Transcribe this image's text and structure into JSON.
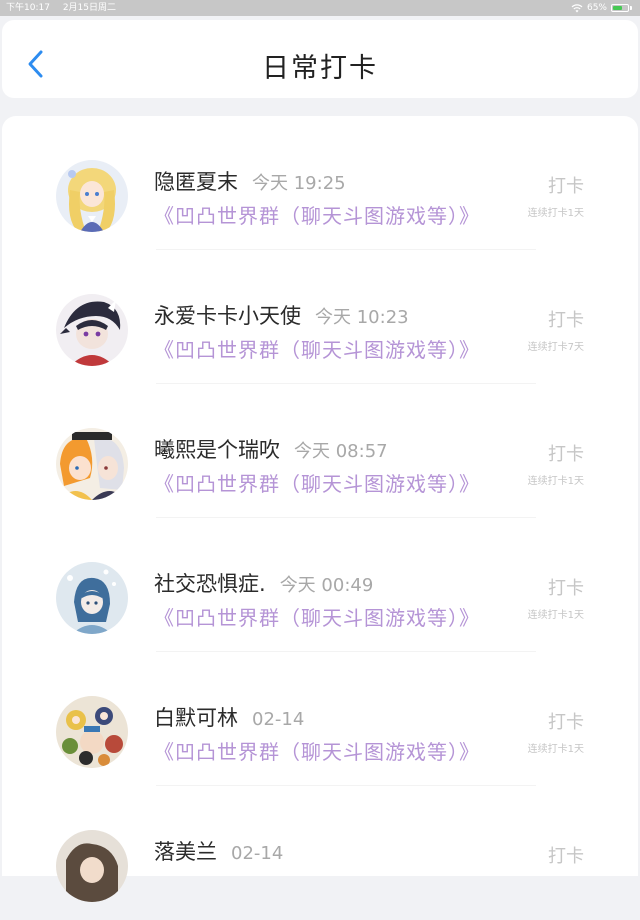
{
  "status_bar": {
    "time": "下午10:17",
    "date": "2月15日周二",
    "battery": "65%",
    "battery_level": 0.65
  },
  "header": {
    "title": "日常打卡",
    "back_icon": "chevron-left-icon",
    "accent_color": "#2d8cf0"
  },
  "entries": [
    {
      "name": "隐匿夏末",
      "time": "今天 19:25",
      "group": "《凹凸世界群（聊天斗图游戏等）》",
      "action": "打卡",
      "streak": "连续打卡1天"
    },
    {
      "name": "永爱卡卡小天使",
      "time": "今天 10:23",
      "group": "《凹凸世界群（聊天斗图游戏等）》",
      "action": "打卡",
      "streak": "连续打卡7天"
    },
    {
      "name": "曦熙是个瑞吹",
      "time": "今天 08:57",
      "group": "《凹凸世界群（聊天斗图游戏等）》",
      "action": "打卡",
      "streak": "连续打卡1天"
    },
    {
      "name": "社交恐惧症.",
      "time": "今天 00:49",
      "group": "《凹凸世界群（聊天斗图游戏等）》",
      "action": "打卡",
      "streak": "连续打卡1天"
    },
    {
      "name": "白默可林",
      "time": "02-14",
      "group": "《凹凸世界群（聊天斗图游戏等）》",
      "action": "打卡",
      "streak": "连续打卡1天"
    },
    {
      "name": "落美兰",
      "time": "02-14",
      "group": "",
      "action": "打卡",
      "streak": ""
    }
  ],
  "colors": {
    "group_link": "#b594d6",
    "muted": "#c6c6c6"
  }
}
